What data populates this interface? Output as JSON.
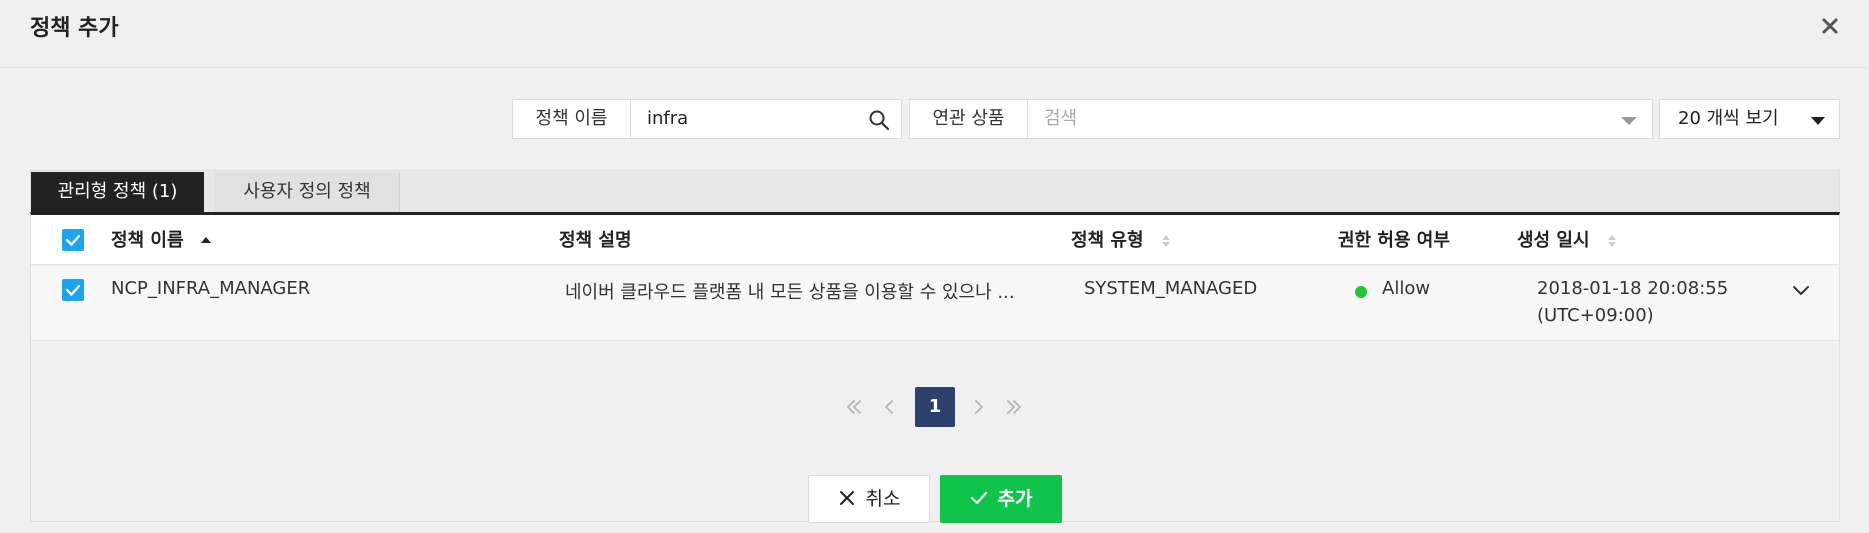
{
  "dialog": {
    "title": "정책 추가"
  },
  "filters": {
    "policy_name_label": "정책 이름",
    "policy_name_value": "infra",
    "product_label": "연관 상품",
    "product_placeholder": "검색",
    "page_size_label": "20 개씩 보기"
  },
  "tabs": [
    {
      "label": "관리형 정책 (1)",
      "active": true
    },
    {
      "label": "사용자 정의 정책",
      "active": false
    }
  ],
  "table": {
    "headers": {
      "name": "정책 이름",
      "description": "정책 설명",
      "type": "정책 유형",
      "permission": "권한 허용 여부",
      "created": "생성 일시"
    },
    "header_checked": true,
    "rows": [
      {
        "checked": true,
        "name": "NCP_INFRA_MANAGER",
        "description": "네이버 클라우드 플랫폼 내 모든 상품을 이용할 수 있으나 ...",
        "type": "SYSTEM_MANAGED",
        "permission": "Allow",
        "permission_color": "#1ec837",
        "created_line1": "2018-01-18 20:08:55",
        "created_line2": "(UTC+09:00)"
      }
    ]
  },
  "pagination": {
    "current": "1"
  },
  "buttons": {
    "cancel": "취소",
    "add": "추가"
  },
  "colors": {
    "accent_checkbox": "#1ba5f1",
    "add_button": "#0fc34b",
    "page_current": "#2d3f6b"
  }
}
